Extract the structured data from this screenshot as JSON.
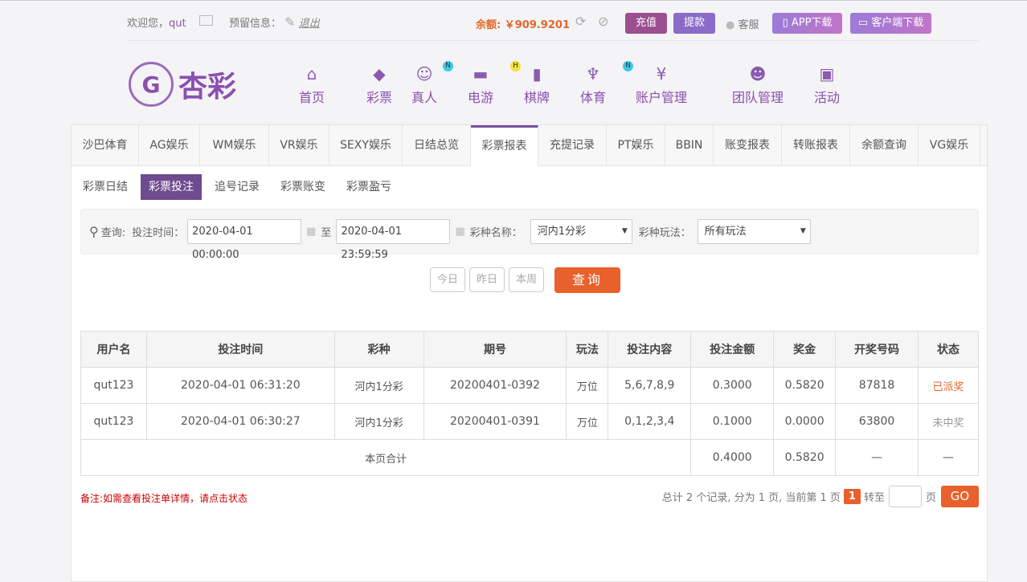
{
  "header": {
    "welcome": "欢迎您，",
    "username": "qut",
    "reserved_info": "预留信息：",
    "logout": "退出",
    "balance_label": "余额:",
    "balance": "￥909.9201",
    "recharge": "充值",
    "withdraw": "提款",
    "service": "客服",
    "app_download": "APP下载",
    "client_download": "客户端下载"
  },
  "logo": {
    "text": "杏彩"
  },
  "nav": [
    {
      "label": "首页",
      "icon": "home-icon",
      "badge": ""
    },
    {
      "label": "彩票",
      "icon": "ticket-icon",
      "badge": ""
    },
    {
      "label": "真人",
      "icon": "woman-icon",
      "badge": "N"
    },
    {
      "label": "电游",
      "icon": "gamepad-icon",
      "badge": "H"
    },
    {
      "label": "棋牌",
      "icon": "cards-icon",
      "badge": ""
    },
    {
      "label": "体育",
      "icon": "trophy-icon",
      "badge": "N"
    },
    {
      "label": "账户管理",
      "icon": "yen-icon",
      "badge": ""
    },
    {
      "label": "团队管理",
      "icon": "team-icon",
      "badge": ""
    },
    {
      "label": "活动",
      "icon": "gift-icon",
      "badge": ""
    }
  ],
  "tabs": [
    "沙巴体育",
    "AG娱乐",
    "WM娱乐",
    "VR娱乐",
    "SEXY娱乐",
    "日结总览",
    "彩票报表",
    "充提记录",
    "PT娱乐",
    "BBIN",
    "账变报表",
    "转账报表",
    "余额查询",
    "VG娱乐"
  ],
  "subtabs": [
    "彩票日结",
    "彩票投注",
    "追号记录",
    "彩票账变",
    "彩票盈亏"
  ],
  "filter": {
    "query": "查询:",
    "time_label": "投注时间：",
    "start": "2020-04-01 00:00:00",
    "to": "至",
    "end": "2020-04-01 23:59:59",
    "lottery_label": "彩种名称：",
    "lottery": "河内1分彩",
    "play_label": "彩种玩法：",
    "play": "所有玩法",
    "today": "今日",
    "yesterday": "昨日",
    "week": "本周",
    "search": "查询"
  },
  "table": {
    "headers": [
      "用户名",
      "投注时间",
      "彩种",
      "期号",
      "玩法",
      "投注内容",
      "投注金额",
      "奖金",
      "开奖号码",
      "状态"
    ],
    "rows": [
      [
        "qut123",
        "2020-04-01 06:31:20",
        "河内1分彩",
        "20200401-0392",
        "万位",
        "5,6,7,8,9",
        "0.3000",
        "0.5820",
        "87818",
        "已派奖"
      ],
      [
        "qut123",
        "2020-04-01 06:30:27",
        "河内1分彩",
        "20200401-0391",
        "万位",
        "0,1,2,3,4",
        "0.1000",
        "0.0000",
        "63800",
        "未中奖"
      ]
    ],
    "total": {
      "label": "本页合计",
      "amount": "0.4000",
      "bonus": "0.5820",
      "code": "—",
      "status": "—"
    }
  },
  "footer": {
    "note": "备注:如需查看投注单详情，请点击状态",
    "summary": "总计 2 个记录, 分为 1 页, 当前第 1 页",
    "page": "1",
    "goto": "转至",
    "page_unit": "页",
    "go": "GO"
  }
}
